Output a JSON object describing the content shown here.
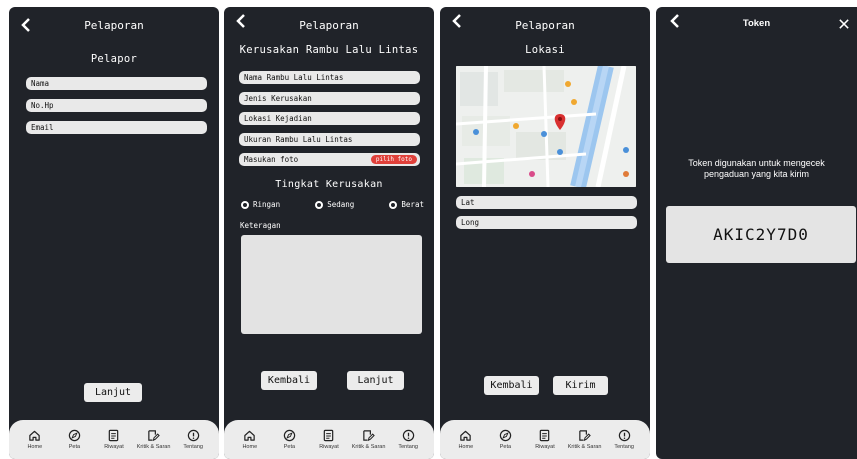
{
  "screen1": {
    "title": "Pelaporan",
    "subtitle": "Pelapor",
    "fields": [
      "Nama",
      "No.Hp",
      "Email"
    ],
    "next_label": "Lanjut"
  },
  "screen2": {
    "title": "Pelaporan",
    "subtitle": "Kerusakan Rambu Lalu Lintas",
    "fields": [
      "Nama Rambu Lalu Lintas",
      "Jenis Kerusakan",
      "Lokasi Kejadian",
      "Ukuran Rambu Lalu Lintas"
    ],
    "photo_label": "Masukan foto",
    "photo_button": "pilih foto",
    "damage_title": "Tingkat Kerusakan",
    "damage_options": [
      "Ringan",
      "Sedang",
      "Berat"
    ],
    "notes_label": "Keteragan",
    "back_label": "Kembali",
    "next_label": "Lanjut"
  },
  "screen3": {
    "title": "Pelaporan",
    "subtitle": "Lokasi",
    "fields": [
      "Lat",
      "Long"
    ],
    "back_label": "Kembali",
    "send_label": "Kirim"
  },
  "screen4": {
    "title": "Token",
    "description": "Token digunakan untuk mengecek pengaduan yang kita kirim",
    "token": "AKIC2Y7D0"
  },
  "navbar": {
    "items": [
      {
        "label": "Home",
        "icon": "home-icon"
      },
      {
        "label": "Peta",
        "icon": "compass-icon"
      },
      {
        "label": "Riwayat",
        "icon": "document-icon"
      },
      {
        "label": "Kritik & Saran",
        "icon": "edit-icon"
      },
      {
        "label": "Tentang",
        "icon": "info-icon"
      }
    ]
  },
  "colors": {
    "screen_bg": "#202329",
    "field_bg": "#e9e9e9",
    "accent_red": "#e0403a",
    "navbar_bg": "#ececec"
  }
}
